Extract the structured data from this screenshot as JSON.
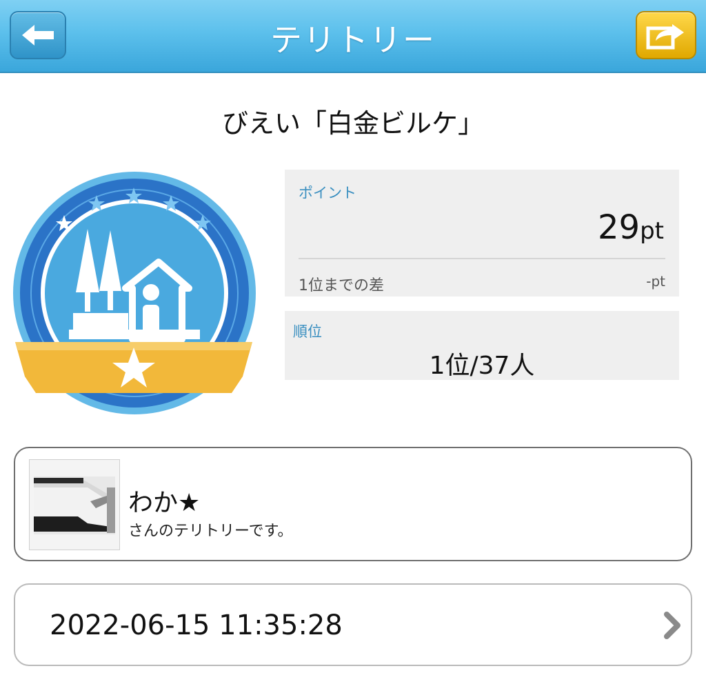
{
  "header": {
    "title": "テリトリー",
    "back_icon": "arrow-left-icon",
    "share_icon": "share-icon"
  },
  "territory": {
    "name": "びえい「白金ビルケ」"
  },
  "points_panel": {
    "label": "ポイント",
    "value": "29",
    "unit": "pt",
    "gap_label": "1位までの差",
    "gap_value": "-pt"
  },
  "rank_panel": {
    "label": "順位",
    "value": "1位/37人"
  },
  "owner": {
    "name": "わか★",
    "subtitle": "さんのテリトリーです。"
  },
  "visit": {
    "datetime": "2022-06-15 11:35:28",
    "chevron_icon": "chevron-right-icon"
  },
  "colors": {
    "header_blue": "#5cc0ec",
    "badge_blue": "#4aa9df",
    "badge_ring": "#2b73c7",
    "ribbon_gold": "#f2b83a",
    "label_blue": "#3a8fc0",
    "panel_gray": "#efefef"
  }
}
